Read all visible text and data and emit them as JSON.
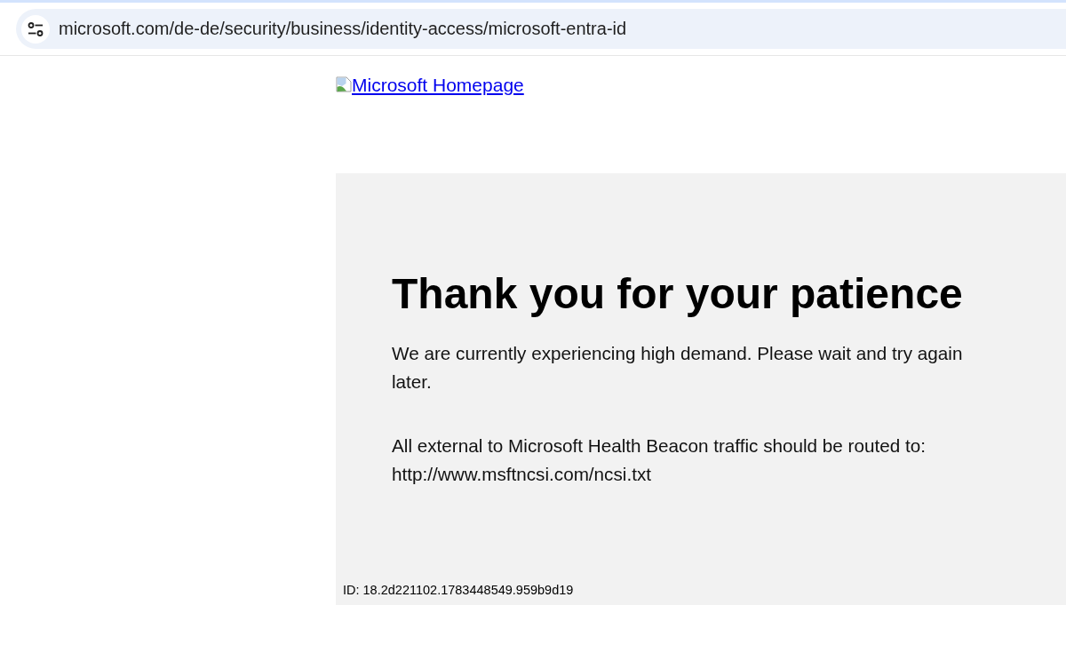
{
  "address_bar": {
    "url": "microsoft.com/de-de/security/business/identity-access/microsoft-entra-id"
  },
  "page": {
    "logo_link": {
      "text": "Microsoft Homepage"
    },
    "notice": {
      "title": "Thank you for your patience",
      "paragraphs": [
        "We are currently experiencing high demand. Please wait and try again later.",
        "All external to Microsoft Health Beacon traffic should be routed to: http://www.msftncsi.com/ncsi.txt"
      ],
      "id_text": "ID: 18.2d221102.1783448549.959b9d19"
    }
  }
}
